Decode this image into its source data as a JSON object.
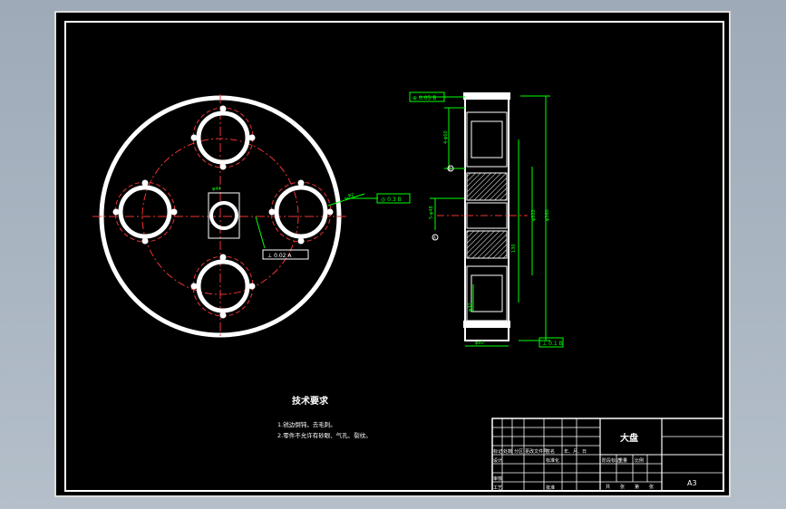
{
  "drawing": {
    "part_title": "大盘",
    "tech_requirements": {
      "heading": "技术要求",
      "items": [
        "1.锐边倒钝，去毛刺。",
        "2.零件不允许有砂眼、气孔、裂纹。"
      ]
    },
    "title_block": {
      "sheet_size": "A3",
      "header_row": [
        "标记",
        "处数",
        "分区",
        "更改文件号",
        "签名",
        "年、月、日"
      ],
      "rows": [
        {
          "label": "设计",
          "value": "标准化"
        },
        {
          "label": "审核",
          "value": ""
        },
        {
          "label": "工艺",
          "value": "批准"
        }
      ],
      "stage_labels": [
        "阶段标记",
        "重量",
        "比例"
      ],
      "sheet_labels": [
        "共",
        "张",
        "第",
        "张"
      ]
    },
    "annotations": {
      "tol_frame_top": [
        "⊕",
        "0.05",
        "B"
      ],
      "tol_frame_side": [
        "◎",
        "0.3",
        "B"
      ],
      "tol_frame_center": [
        "⊥",
        "0.02",
        "A"
      ],
      "tol_frame_bottom": [
        "⊥",
        "0.1",
        "B"
      ],
      "datum_a": "A",
      "datum_b": "B",
      "small_dims": [
        "φ1",
        "φ44",
        "4-φ60",
        "5-φ48",
        "φ80",
        "φ360",
        "φ322",
        "φ32",
        "130"
      ]
    },
    "colors": {
      "geometry": "#ffffff",
      "centerline": "#ff2020",
      "dimension": "#00ff00",
      "background": "#000000"
    }
  }
}
